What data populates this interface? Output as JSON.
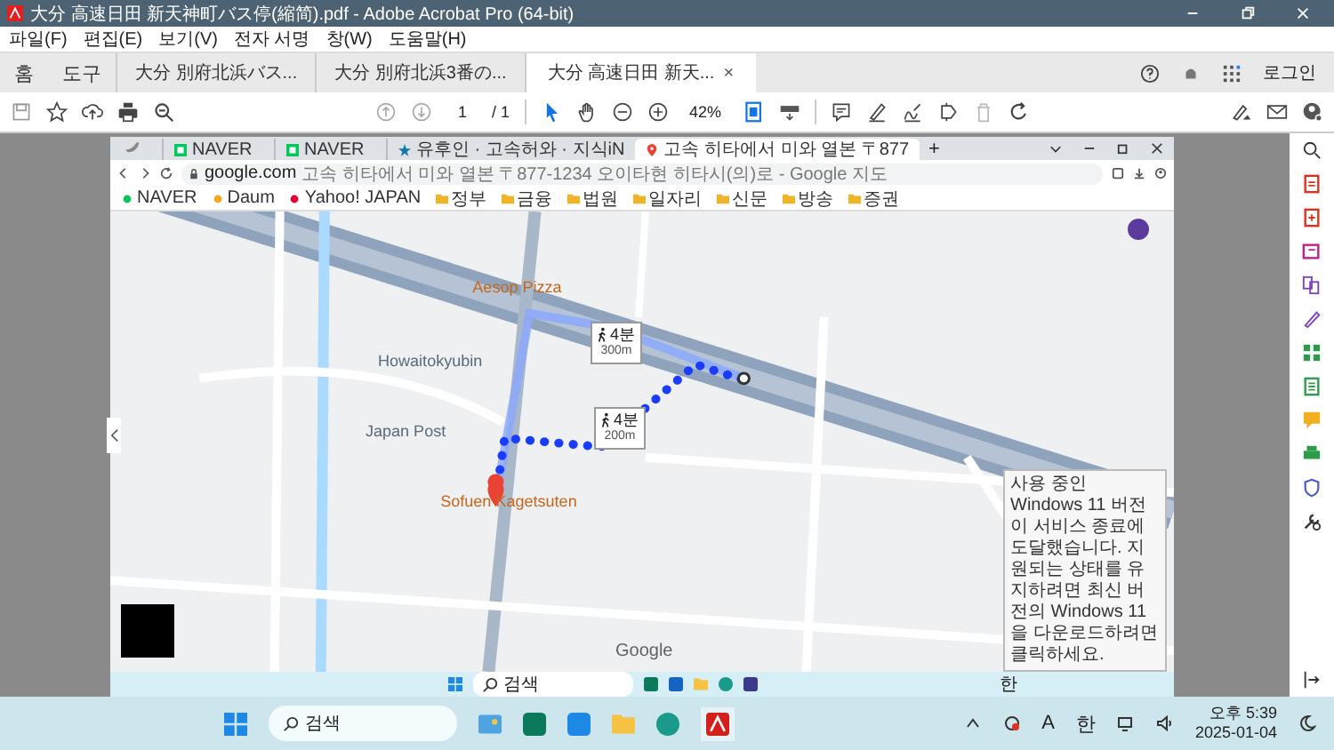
{
  "window": {
    "title": "大分 高速日田 新天神町バス停(縮简).pdf - Adobe Acrobat Pro (64-bit)"
  },
  "menu": [
    "파일(F)",
    "편집(E)",
    "보기(V)",
    "전자 서명",
    "창(W)",
    "도움말(H)"
  ],
  "tabs": [
    {
      "label": "홈",
      "kind": "nav",
      "selected": false
    },
    {
      "label": "도구",
      "kind": "nav",
      "selected": false
    },
    {
      "label": "大分 別府北浜バス...",
      "kind": "doc",
      "selected": false
    },
    {
      "label": "大分 別府北浜3番の...",
      "kind": "doc",
      "selected": false
    },
    {
      "label": "大分 高速日田 新天...",
      "kind": "doc",
      "selected": true,
      "close": "×"
    }
  ],
  "account": {
    "login": "로그인"
  },
  "toolbar": {
    "page": "1",
    "page_total": "/ 1",
    "zoom": "42%"
  },
  "document": {
    "browser": {
      "tabs": [
        {
          "label": "NAVER",
          "kind": "naver",
          "selected": false
        },
        {
          "label": "NAVER",
          "kind": "naver",
          "selected": false
        },
        {
          "label": "유후인 · 고속허와 · 지식iN",
          "kind": "star",
          "selected": false
        },
        {
          "label": "고속 히타에서 미와 열본 〒877",
          "kind": "maps",
          "selected": true
        }
      ],
      "new_tab": "+",
      "address": {
        "domain": "google.com",
        "path": "고속 히타에서 미와 열본 〒877-1234 오이타현 히타시(의)로 - Google 지도"
      },
      "bookmarks": [
        {
          "label": "NAVER",
          "kind": "site",
          "color": "#03c75a"
        },
        {
          "label": "Daum",
          "kind": "site",
          "color": "#f5a623"
        },
        {
          "label": "Yahoo! JAPAN",
          "kind": "site",
          "color": "#e60033"
        },
        {
          "label": "정부",
          "kind": "folder"
        },
        {
          "label": "금융",
          "kind": "folder"
        },
        {
          "label": "법원",
          "kind": "folder"
        },
        {
          "label": "일자리",
          "kind": "folder"
        },
        {
          "label": "신문",
          "kind": "folder"
        },
        {
          "label": "방송",
          "kind": "folder"
        },
        {
          "label": "증권",
          "kind": "folder"
        }
      ],
      "taskbar": {
        "search": "검색",
        "ime": "한"
      }
    },
    "map": {
      "labels": [
        {
          "text": "Aesop Pizza",
          "kind": "food"
        },
        {
          "text": "Japan Post",
          "kind": "place"
        },
        {
          "text": "Sofuen Kagetsuten",
          "kind": "food"
        },
        {
          "text": "Howaitokyubin",
          "kind": "place"
        }
      ],
      "routes": [
        {
          "time": "4분",
          "distance": "300m",
          "selected": false
        },
        {
          "time": "4분",
          "distance": "200m",
          "selected": true
        }
      ],
      "credit": "Google"
    },
    "notification": "사용 중인 Windows 11 버전이 서비스 종료에 도달했습니다. 지원되는 상태를 유지하려면 최신 버전의 Windows 11을 다운로드하려면 클릭하세요."
  },
  "taskbar": {
    "search": "검색",
    "input": "A",
    "ime": "한",
    "time": "오후 5:39",
    "date": "2025-01-04"
  }
}
